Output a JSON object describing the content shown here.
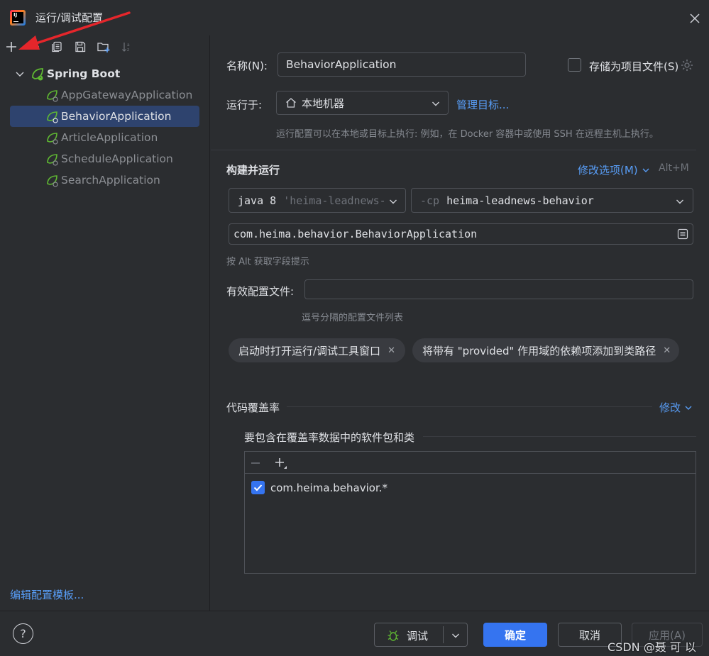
{
  "window": {
    "title": "运行/调试配置"
  },
  "toolbar": {
    "add": "add-icon",
    "remove": "remove-icon",
    "copy": "copy-icon",
    "save": "save-icon",
    "folder": "new-folder-icon",
    "sort": "sort-icon"
  },
  "tree": {
    "root": "Spring Boot",
    "items": [
      {
        "label": "AppGatewayApplication",
        "selected": false
      },
      {
        "label": "BehaviorApplication",
        "selected": true
      },
      {
        "label": "ArticleApplication",
        "selected": false
      },
      {
        "label": "ScheduleApplication",
        "selected": false
      },
      {
        "label": "SearchApplication",
        "selected": false
      }
    ],
    "edit_templates": "编辑配置模板..."
  },
  "form": {
    "name_label": "名称(N):",
    "name_value": "BehaviorApplication",
    "store_label": "存储为项目文件(S)",
    "run_on_label": "运行于:",
    "run_on_value": "本地机器",
    "manage_targets": "管理目标...",
    "run_on_hint": "运行配置可以在本地或目标上执行: 例如，在 Docker 容器中或使用 SSH 在远程主机上执行。",
    "build_run_title": "构建并运行",
    "modify_options": "修改选项(M)",
    "modify_shortcut": "Alt+M",
    "jdk_main": "java 8",
    "jdk_hint": "'heima-leadnews-",
    "cp_prefix": "-cp",
    "cp_value": "heima-leadnews-behavior",
    "main_class": "com.heima.behavior.BehaviorApplication",
    "alt_hint": "按 Alt 获取字段提示",
    "profiles_label": "有效配置文件:",
    "profiles_value": "",
    "profiles_hint": "逗号分隔的配置文件列表",
    "chip1": "启动时打开运行/调试工具窗口",
    "chip2": "将带有 \"provided\" 作用域的依赖项添加到类路径",
    "coverage_title": "代码覆盖率",
    "coverage_modify": "修改",
    "coverage_sub": "要包含在覆盖率数据中的软件包和类",
    "coverage_item": "com.heima.behavior.*"
  },
  "bottom": {
    "help": "?",
    "debug": "调试",
    "ok": "确定",
    "cancel": "取消",
    "apply": "应用(A)",
    "watermark": "CSDN @聂 可 以"
  },
  "colors": {
    "accent": "#3574f0",
    "link": "#589df6",
    "selected": "#2e436e",
    "arrow": "#e5262b",
    "spring": "#5fb832"
  }
}
